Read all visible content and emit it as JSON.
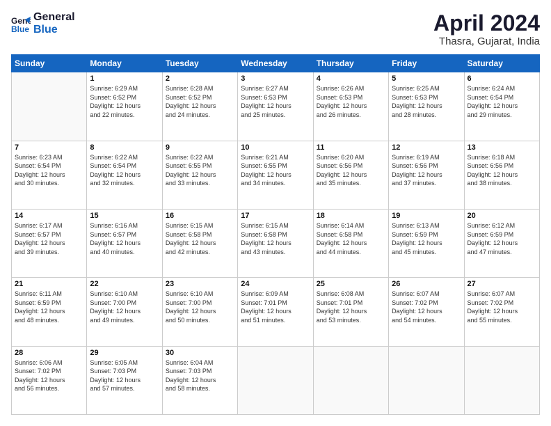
{
  "header": {
    "logo_line1": "General",
    "logo_line2": "Blue",
    "title": "April 2024",
    "subtitle": "Thasra, Gujarat, India"
  },
  "columns": [
    "Sunday",
    "Monday",
    "Tuesday",
    "Wednesday",
    "Thursday",
    "Friday",
    "Saturday"
  ],
  "weeks": [
    [
      {
        "day": "",
        "info": ""
      },
      {
        "day": "1",
        "info": "Sunrise: 6:29 AM\nSunset: 6:52 PM\nDaylight: 12 hours\nand 22 minutes."
      },
      {
        "day": "2",
        "info": "Sunrise: 6:28 AM\nSunset: 6:52 PM\nDaylight: 12 hours\nand 24 minutes."
      },
      {
        "day": "3",
        "info": "Sunrise: 6:27 AM\nSunset: 6:53 PM\nDaylight: 12 hours\nand 25 minutes."
      },
      {
        "day": "4",
        "info": "Sunrise: 6:26 AM\nSunset: 6:53 PM\nDaylight: 12 hours\nand 26 minutes."
      },
      {
        "day": "5",
        "info": "Sunrise: 6:25 AM\nSunset: 6:53 PM\nDaylight: 12 hours\nand 28 minutes."
      },
      {
        "day": "6",
        "info": "Sunrise: 6:24 AM\nSunset: 6:54 PM\nDaylight: 12 hours\nand 29 minutes."
      }
    ],
    [
      {
        "day": "7",
        "info": "Sunrise: 6:23 AM\nSunset: 6:54 PM\nDaylight: 12 hours\nand 30 minutes."
      },
      {
        "day": "8",
        "info": "Sunrise: 6:22 AM\nSunset: 6:54 PM\nDaylight: 12 hours\nand 32 minutes."
      },
      {
        "day": "9",
        "info": "Sunrise: 6:22 AM\nSunset: 6:55 PM\nDaylight: 12 hours\nand 33 minutes."
      },
      {
        "day": "10",
        "info": "Sunrise: 6:21 AM\nSunset: 6:55 PM\nDaylight: 12 hours\nand 34 minutes."
      },
      {
        "day": "11",
        "info": "Sunrise: 6:20 AM\nSunset: 6:56 PM\nDaylight: 12 hours\nand 35 minutes."
      },
      {
        "day": "12",
        "info": "Sunrise: 6:19 AM\nSunset: 6:56 PM\nDaylight: 12 hours\nand 37 minutes."
      },
      {
        "day": "13",
        "info": "Sunrise: 6:18 AM\nSunset: 6:56 PM\nDaylight: 12 hours\nand 38 minutes."
      }
    ],
    [
      {
        "day": "14",
        "info": "Sunrise: 6:17 AM\nSunset: 6:57 PM\nDaylight: 12 hours\nand 39 minutes."
      },
      {
        "day": "15",
        "info": "Sunrise: 6:16 AM\nSunset: 6:57 PM\nDaylight: 12 hours\nand 40 minutes."
      },
      {
        "day": "16",
        "info": "Sunrise: 6:15 AM\nSunset: 6:58 PM\nDaylight: 12 hours\nand 42 minutes."
      },
      {
        "day": "17",
        "info": "Sunrise: 6:15 AM\nSunset: 6:58 PM\nDaylight: 12 hours\nand 43 minutes."
      },
      {
        "day": "18",
        "info": "Sunrise: 6:14 AM\nSunset: 6:58 PM\nDaylight: 12 hours\nand 44 minutes."
      },
      {
        "day": "19",
        "info": "Sunrise: 6:13 AM\nSunset: 6:59 PM\nDaylight: 12 hours\nand 45 minutes."
      },
      {
        "day": "20",
        "info": "Sunrise: 6:12 AM\nSunset: 6:59 PM\nDaylight: 12 hours\nand 47 minutes."
      }
    ],
    [
      {
        "day": "21",
        "info": "Sunrise: 6:11 AM\nSunset: 6:59 PM\nDaylight: 12 hours\nand 48 minutes."
      },
      {
        "day": "22",
        "info": "Sunrise: 6:10 AM\nSunset: 7:00 PM\nDaylight: 12 hours\nand 49 minutes."
      },
      {
        "day": "23",
        "info": "Sunrise: 6:10 AM\nSunset: 7:00 PM\nDaylight: 12 hours\nand 50 minutes."
      },
      {
        "day": "24",
        "info": "Sunrise: 6:09 AM\nSunset: 7:01 PM\nDaylight: 12 hours\nand 51 minutes."
      },
      {
        "day": "25",
        "info": "Sunrise: 6:08 AM\nSunset: 7:01 PM\nDaylight: 12 hours\nand 53 minutes."
      },
      {
        "day": "26",
        "info": "Sunrise: 6:07 AM\nSunset: 7:02 PM\nDaylight: 12 hours\nand 54 minutes."
      },
      {
        "day": "27",
        "info": "Sunrise: 6:07 AM\nSunset: 7:02 PM\nDaylight: 12 hours\nand 55 minutes."
      }
    ],
    [
      {
        "day": "28",
        "info": "Sunrise: 6:06 AM\nSunset: 7:02 PM\nDaylight: 12 hours\nand 56 minutes."
      },
      {
        "day": "29",
        "info": "Sunrise: 6:05 AM\nSunset: 7:03 PM\nDaylight: 12 hours\nand 57 minutes."
      },
      {
        "day": "30",
        "info": "Sunrise: 6:04 AM\nSunset: 7:03 PM\nDaylight: 12 hours\nand 58 minutes."
      },
      {
        "day": "",
        "info": ""
      },
      {
        "day": "",
        "info": ""
      },
      {
        "day": "",
        "info": ""
      },
      {
        "day": "",
        "info": ""
      }
    ]
  ]
}
